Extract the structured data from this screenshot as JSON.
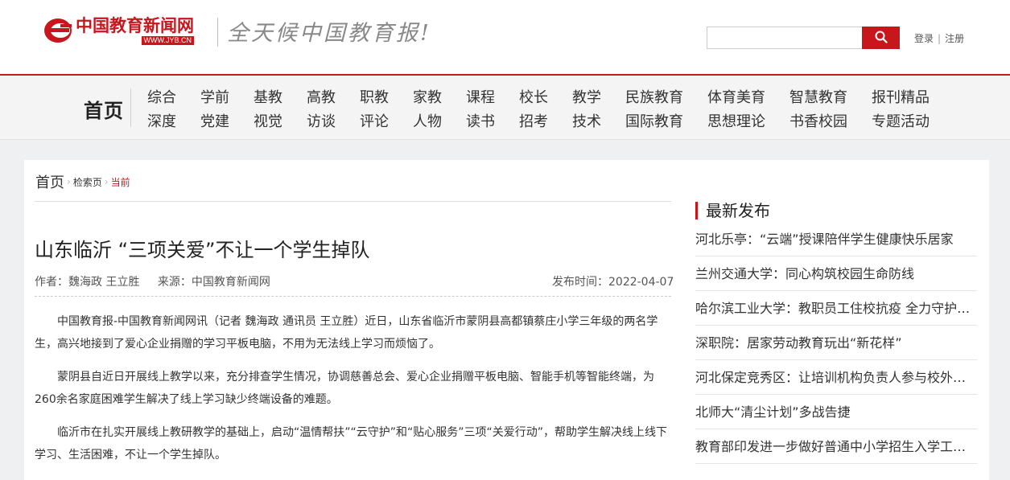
{
  "header": {
    "logo_cn": "中国教育新闻网",
    "logo_url": "WWW.JYB.CN",
    "slogan": "全天候中国教育报!",
    "search_placeholder": "",
    "login": "登录",
    "register": "注册",
    "auth_sep": "|"
  },
  "nav": {
    "home": "首页",
    "row1": [
      "综合",
      "学前",
      "基教",
      "高教",
      "职教",
      "家教",
      "课程",
      "校长",
      "教学",
      "民族教育",
      "体育美育",
      "智慧教育",
      "报刊精品"
    ],
    "row2": [
      "深度",
      "党建",
      "视觉",
      "访谈",
      "评论",
      "人物",
      "读书",
      "招考",
      "技术",
      "国际教育",
      "思想理论",
      "书香校园",
      "专题活动"
    ]
  },
  "breadcrumb": {
    "home": "首页",
    "search": "检索页",
    "current": "当前"
  },
  "article": {
    "title": "山东临沂 “三项关爱”不让一个学生掉队",
    "author": "作者：魏海政 王立胜",
    "source": "来源：中国教育新闻网",
    "pubtime": "发布时间：2022-04-07",
    "paragraphs": [
      "中国教育报-中国教育新闻网讯（记者 魏海政 通讯员 王立胜）近日，山东省临沂市蒙阴县高都镇蔡庄小学三年级的两名学生，高兴地接到了爱心企业捐赠的学习平板电脑，不用为无法线上学习而烦恼了。",
      "蒙阴县自近日开展线上教学以来，充分排查学生情况，协调慈善总会、爱心企业捐赠平板电脑、智能手机等智能终端，为260余名家庭困难学生解决了线上学习缺少终端设备的难题。",
      "临沂市在扎实开展线上教研教学的基础上，启动“温情帮扶”“云守护”和“贴心服务”三项“关爱行动”，帮助学生解决线上线下学习、生活困难，不让一个学生掉队。"
    ]
  },
  "sidebar": {
    "title": "最新发布",
    "items": [
      "河北乐亭：“云端”授课陪伴学生健康快乐居家",
      "兰州交通大学：同心构筑校园生命防线",
      "哈尔滨工业大学：教职员工住校抗疫 全力守护学生",
      "深职院：居家劳动教育玩出“新花样”",
      "河北保定竞秀区：让培训机构负责人参与校外培训治理",
      "北师大“清尘计划”多战告捷",
      "教育部印发进一步做好普通中小学招生入学工作的通知"
    ]
  },
  "colors": {
    "brand_red": "#c8161d",
    "nav_bg": "#f4f4f4",
    "page_bg": "#eef0f2"
  },
  "icons": {
    "search": "search-icon",
    "breadcrumb_arrow": "chevron-right-icon",
    "logo": "jyb-logo-mark"
  }
}
